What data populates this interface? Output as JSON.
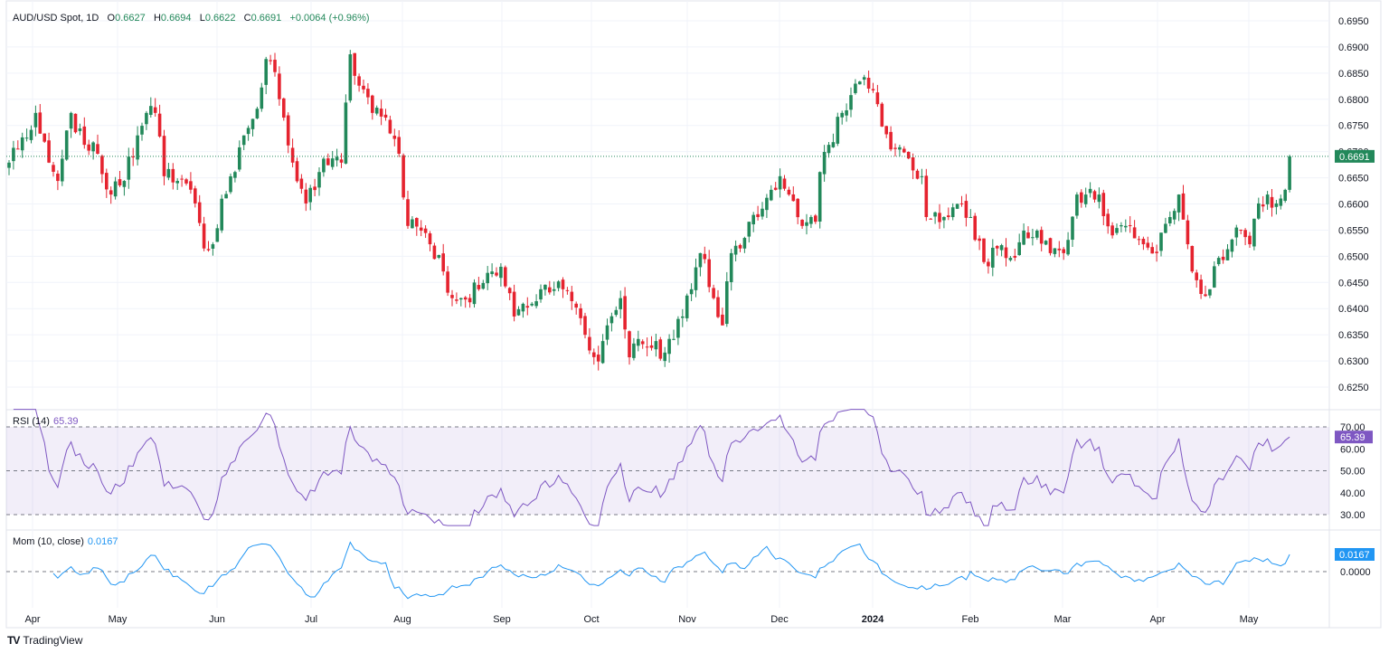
{
  "header": {
    "symbol": "AUD/USD Spot, 1D",
    "open_label": "O",
    "open": "0.6627",
    "high_label": "H",
    "high": "0.6694",
    "low_label": "L",
    "low": "0.6622",
    "close_label": "C",
    "close": "0.6691",
    "change": "+0.0064 (+0.96%)"
  },
  "last_price_tag": "0.6691",
  "rsi": {
    "label": "RSI (14)",
    "value": "65.39",
    "axis": [
      "70.00",
      "60.00",
      "50.00",
      "40.00",
      "30.00"
    ]
  },
  "mom": {
    "label": "Mom (10, close)",
    "value": "0.0167",
    "axis": [
      "0.0000"
    ]
  },
  "branding": "TradingView",
  "colors": {
    "up": "#22885a",
    "down": "#e5232f",
    "rsi": "#7e57c2",
    "mom": "#2196f3"
  },
  "chart_data": {
    "type": "candlestick",
    "title": "AUD/USD Spot, 1D",
    "ylim": [
      0.6225,
      0.6975
    ],
    "y_ticks": [
      "0.6950",
      "0.6900",
      "0.6850",
      "0.6800",
      "0.6750",
      "0.6700",
      "0.6650",
      "0.6600",
      "0.6550",
      "0.6500",
      "0.6450",
      "0.6400",
      "0.6350",
      "0.6300",
      "0.6250"
    ],
    "x_ticks": [
      "Apr",
      "May",
      "Jun",
      "Jul",
      "Aug",
      "Sep",
      "Oct",
      "Nov",
      "Dec",
      "2024",
      "Feb",
      "Mar",
      "Apr",
      "May"
    ],
    "approx_close_path": [
      [
        0,
        0.6679
      ],
      [
        2,
        0.6705
      ],
      [
        6,
        0.6774
      ],
      [
        9,
        0.6679
      ],
      [
        11,
        0.6644
      ],
      [
        14,
        0.6774
      ],
      [
        17,
        0.6713
      ],
      [
        20,
        0.6696
      ],
      [
        23,
        0.6618
      ],
      [
        26,
        0.6644
      ],
      [
        29,
        0.6731
      ],
      [
        31,
        0.6774
      ],
      [
        33,
        0.6774
      ],
      [
        35,
        0.6653
      ],
      [
        38,
        0.6644
      ],
      [
        42,
        0.6601
      ],
      [
        44,
        0.6515
      ],
      [
        46,
        0.6523
      ],
      [
        48,
        0.661
      ],
      [
        51,
        0.6661
      ],
      [
        53,
        0.6731
      ],
      [
        56,
        0.6782
      ],
      [
        58,
        0.6877
      ],
      [
        60,
        0.6852
      ],
      [
        62,
        0.6765
      ],
      [
        64,
        0.6679
      ],
      [
        67,
        0.6601
      ],
      [
        70,
        0.6661
      ],
      [
        73,
        0.6687
      ],
      [
        75,
        0.6679
      ],
      [
        77,
        0.6886
      ],
      [
        79,
        0.6826
      ],
      [
        82,
        0.6774
      ],
      [
        85,
        0.6765
      ],
      [
        88,
        0.6696
      ],
      [
        90,
        0.6558
      ],
      [
        93,
        0.6549
      ],
      [
        95,
        0.6523
      ],
      [
        98,
        0.6471
      ],
      [
        100,
        0.642
      ],
      [
        102,
        0.642
      ],
      [
        106,
        0.6437
      ],
      [
        109,
        0.6471
      ],
      [
        111,
        0.648
      ],
      [
        114,
        0.6385
      ],
      [
        117,
        0.6402
      ],
      [
        120,
        0.6437
      ],
      [
        123,
        0.6437
      ],
      [
        125,
        0.6437
      ],
      [
        128,
        0.6402
      ],
      [
        130,
        0.635
      ],
      [
        133,
        0.6299
      ],
      [
        135,
        0.6368
      ],
      [
        138,
        0.642
      ],
      [
        140,
        0.6307
      ],
      [
        142,
        0.6342
      ],
      [
        145,
        0.6325
      ],
      [
        148,
        0.6316
      ],
      [
        150,
        0.6342
      ],
      [
        152,
        0.6385
      ],
      [
        156,
        0.6506
      ],
      [
        159,
        0.642
      ],
      [
        161,
        0.6368
      ],
      [
        163,
        0.6506
      ],
      [
        165,
        0.6515
      ],
      [
        167,
        0.6566
      ],
      [
        169,
        0.6575
      ],
      [
        172,
        0.6627
      ],
      [
        174,
        0.6653
      ],
      [
        176,
        0.6618
      ],
      [
        179,
        0.6558
      ],
      [
        182,
        0.6566
      ],
      [
        183,
        0.6661
      ],
      [
        185,
        0.6713
      ],
      [
        188,
        0.6774
      ],
      [
        190,
        0.6808
      ],
      [
        192,
        0.6834
      ],
      [
        195,
        0.6817
      ],
      [
        197,
        0.6748
      ],
      [
        200,
        0.6705
      ],
      [
        203,
        0.6687
      ],
      [
        206,
        0.6653
      ],
      [
        207,
        0.6575
      ],
      [
        209,
        0.6584
      ],
      [
        212,
        0.6575
      ],
      [
        215,
        0.6601
      ],
      [
        217,
        0.6575
      ],
      [
        220,
        0.6489
      ],
      [
        223,
        0.6515
      ],
      [
        226,
        0.6497
      ],
      [
        229,
        0.6549
      ],
      [
        232,
        0.6549
      ],
      [
        235,
        0.6506
      ],
      [
        238,
        0.6506
      ],
      [
        241,
        0.6618
      ],
      [
        243,
        0.6618
      ],
      [
        246,
        0.6618
      ],
      [
        249,
        0.654
      ],
      [
        252,
        0.6558
      ],
      [
        256,
        0.6523
      ],
      [
        259,
        0.6506
      ],
      [
        262,
        0.6575
      ],
      [
        264,
        0.6618
      ],
      [
        266,
        0.6523
      ],
      [
        267,
        0.6471
      ],
      [
        269,
        0.6428
      ],
      [
        271,
        0.6437
      ],
      [
        273,
        0.6497
      ],
      [
        276,
        0.6532
      ],
      [
        278,
        0.6549
      ],
      [
        280,
        0.6523
      ],
      [
        282,
        0.6601
      ],
      [
        284,
        0.6618
      ],
      [
        286,
        0.6601
      ],
      [
        288,
        0.6627
      ],
      [
        289,
        0.6691
      ]
    ],
    "indicators": {
      "rsi_period": 14,
      "rsi_levels": [
        70,
        50,
        30
      ],
      "momentum_period": 10,
      "last_rsi": 65.39,
      "last_momentum": 0.0167
    }
  }
}
